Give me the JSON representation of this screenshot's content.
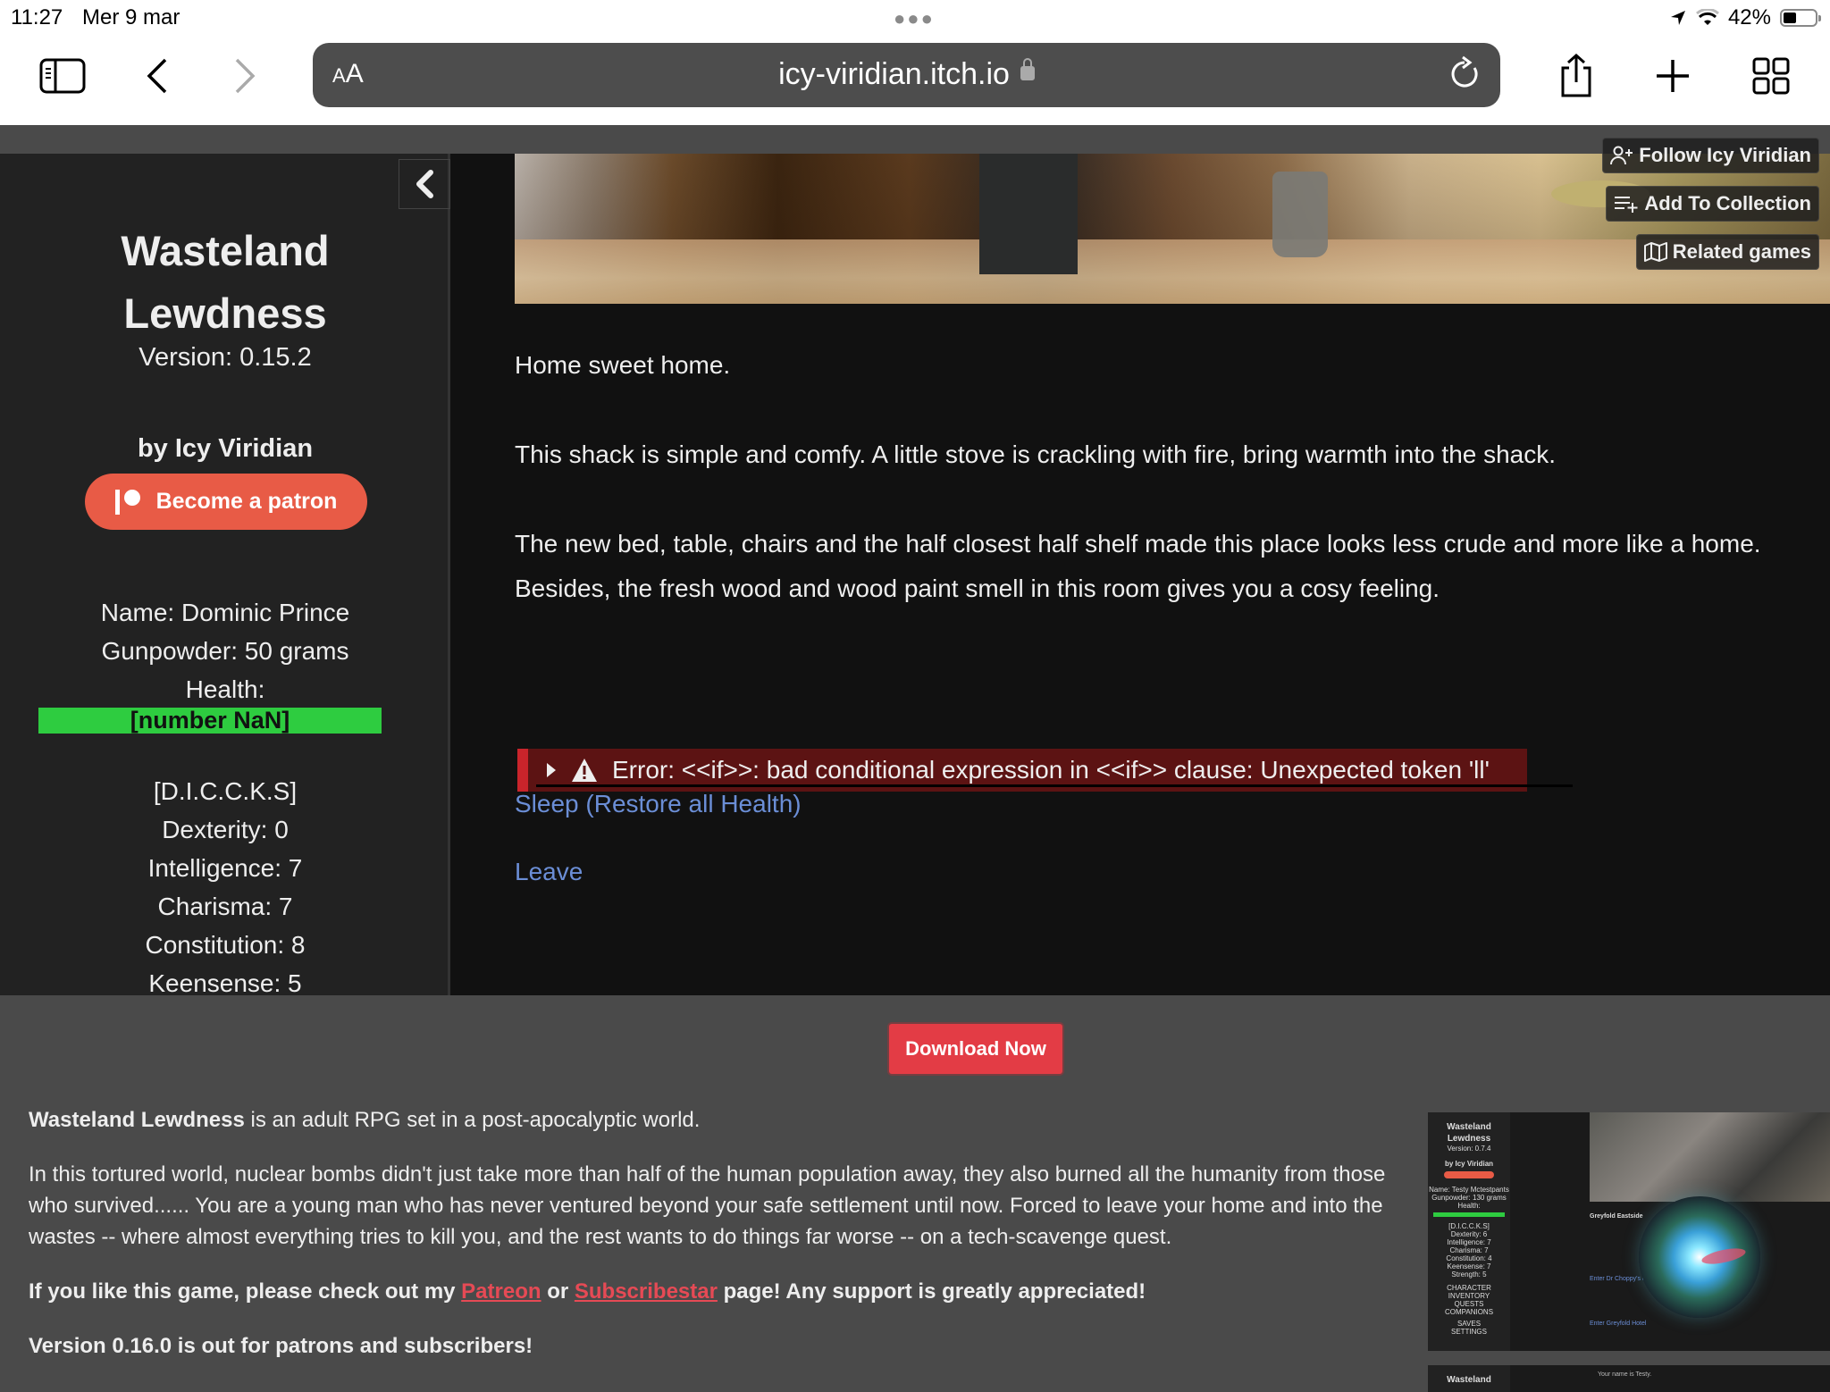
{
  "status_bar": {
    "time": "11:27",
    "date": "Mer 9 mar",
    "battery_percent": "42%",
    "battery_level": 0.42
  },
  "browser": {
    "text_size_label_small": "A",
    "text_size_label_large": "A",
    "url": "icy-viridian.itch.io",
    "icons": [
      "sidebar-icon",
      "back-icon",
      "forward-icon",
      "lock-icon",
      "reload-icon",
      "share-icon",
      "new-tab-icon",
      "tabs-overview-icon"
    ]
  },
  "itch_actions": {
    "follow": "Follow Icy Viridian",
    "add_to_collection": "Add To Collection",
    "related_games": "Related games"
  },
  "game": {
    "sidebar": {
      "title_line1": "Wasteland",
      "title_line2": "Lewdness",
      "version": "Version: 0.15.2",
      "author": "by Icy Viridian",
      "patron_button": "Become a patron",
      "stats": [
        "Name: Dominic Prince",
        "Gunpowder: 50 grams",
        "Health:"
      ],
      "health_value": "[number NaN]",
      "attributes_header": "[D.I.C.C.K.S]",
      "attributes": [
        "Dexterity: 0",
        "Intelligence: 7",
        "Charisma: 7",
        "Constitution: 8",
        "Keensense: 5"
      ]
    },
    "passage": {
      "p1": "Home sweet home.",
      "p2": "This shack is simple and comfy. A little stove is crackling with fire, bring warmth into the shack.",
      "p3a": "The new bed, table, chairs and the half closest half shelf made this place looks less crude and more like a home.",
      "p3b": "Besides, the fresh wood and wood paint smell in this room gives you a cosy feeling."
    },
    "error": "Error: <<if>>: bad conditional expression in <<if>> clause: Unexpected token 'll'",
    "links": {
      "sleep": "Sleep (Restore all Health)",
      "leave": "Leave"
    }
  },
  "itch_page": {
    "download_button": "Download Now",
    "description": {
      "intro_bold": "Wasteland Lewdness",
      "intro_rest": " is an adult RPG set in a post-apocalyptic world.",
      "story": "In this tortured world, nuclear bombs didn't just take more than half of the human population away, they also burned all the humanity from those who survived......  You are a young man who has never ventured beyond your safe settlement until now. Forced to leave your home and into the wastes -- where almost everything tries to kill you, and the rest wants to do things far worse -- on a tech-scavenge quest.",
      "support_prefix": "If you like this game, please check out my ",
      "patreon_link": "Patreon",
      "support_or": " or ",
      "subscribestar_link": "Subscribestar",
      "support_suffix": " page! Any support is greatly appreciated!",
      "version_note": "Version 0.16.0 is out for patrons and subscribers!"
    },
    "screenshot1": {
      "title_line1": "Wasteland",
      "title_line2": "Lewdness",
      "version": "Version: 0.7.4",
      "author": "by Icy Viridian",
      "stats": [
        "Name: Testy Mctestpants",
        "Gunpowder: 130 grams",
        "Health:"
      ],
      "attributes": [
        "[D.I.C.C.K.S]",
        "Dexterity: 6",
        "Intelligence: 7",
        "Charisma: 7",
        "Constitution: 4",
        "Keensense: 7",
        "Strength: 5"
      ],
      "menu": [
        "CHARACTER",
        "INVENTORY",
        "QUESTS",
        "COMPANIONS",
        "SAVES",
        "SETTINGS"
      ],
      "location": "Greyfold Eastside",
      "link1": "Enter Dr Choppy's clinic",
      "link2": "Enter Greyfold Hotel"
    },
    "screenshot2": {
      "title_line1": "Wasteland",
      "text": "Your name is Testy."
    }
  }
}
